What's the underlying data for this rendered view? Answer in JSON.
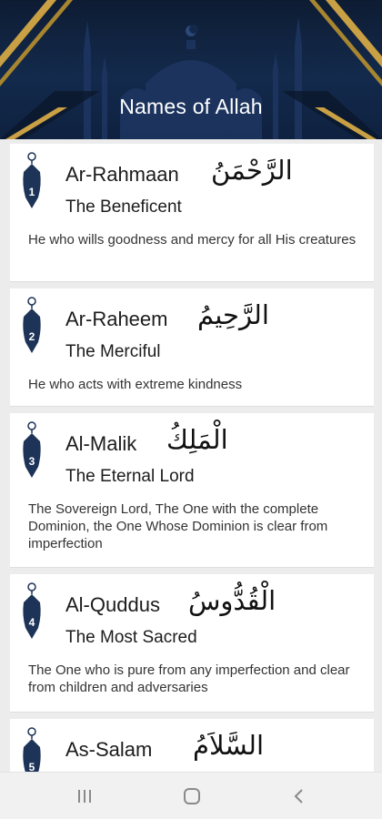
{
  "header": {
    "title": "Names of Allah"
  },
  "names": [
    {
      "number": "1",
      "name": "Ar-Rahmaan",
      "arabic": "الرَّحْمَنُ",
      "meaning": "The Beneficent",
      "description": "He who wills goodness and mercy for all His creatures"
    },
    {
      "number": "2",
      "name": "Ar-Raheem",
      "arabic": "الرَّحِيمُ",
      "meaning": "The Merciful",
      "description": "He who acts with extreme kindness"
    },
    {
      "number": "3",
      "name": "Al-Malik",
      "arabic": "الْمَلِكُ",
      "meaning": "The Eternal Lord",
      "description": "The Sovereign Lord, The One with the complete Dominion, the One Whose Dominion is clear from imperfection"
    },
    {
      "number": "4",
      "name": "Al-Quddus",
      "arabic": "الْقُدُّوسُ",
      "meaning": "The Most Sacred",
      "description": "The One who is pure from any imperfection and clear from children and adversaries"
    },
    {
      "number": "5",
      "name": "As-Salam",
      "arabic": "السَّلاَمُ",
      "meaning": "",
      "description": ""
    }
  ],
  "navbar": {
    "recents_icon": "recents-icon",
    "home_icon": "home-icon",
    "back_icon": "back-icon"
  },
  "colors": {
    "header_bg": "#132a4c",
    "gold_accent": "#c9a043",
    "badge": "#1d3358"
  }
}
